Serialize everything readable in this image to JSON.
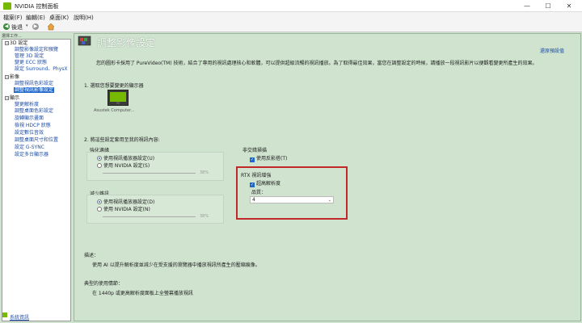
{
  "window": {
    "title": "NVIDIA 控制面板",
    "minimize": "—",
    "maximize": "☐",
    "close": "✕"
  },
  "menu": [
    "檔案(F)",
    "編輯(E)",
    "桌面(K)",
    "說明(H)"
  ],
  "toolbar": {
    "back": "後退",
    "back_glyph": "◀",
    "forward_glyph": "▶"
  },
  "task_label": "選擇工作...",
  "sidebar": {
    "categories": [
      {
        "label": "3D 設定",
        "items": [
          "調整影像設定和預覽",
          "管理 3D 設定",
          "變更 ECC 狀態",
          "設定 Surround、PhysX"
        ]
      },
      {
        "label": "影像",
        "items": [
          "調整視訊色彩設定",
          "調整視訊影像設定"
        ]
      },
      {
        "label": "顯示",
        "items": [
          "變更解析度",
          "調整桌面色彩設定",
          "旋轉顯示畫面",
          "檢視 HDCP 狀態",
          "設定數位音效",
          "調整桌面尺寸和位置",
          "設定 G-SYNC",
          "設定多台顯示器"
        ]
      }
    ],
    "selected": "調整視訊影像設定",
    "system_info": "系統資訊"
  },
  "main": {
    "title": "調整影像設定",
    "restore": "還原預設值",
    "description": "您的圖形卡採用了 PureVideo(TM) 技術，結合了專用的視訊處理核心和軟體，可以提供超級流暢的視訊播放。為了取得最佳效果，當您在調整設定的時候，請播放一段視訊影片以便觀看變更所產生的效果。",
    "section1": "1. 選取您想要變更的顯示器",
    "monitor_label": "Asustek Computer...",
    "section2": "2. 將這些設定套用至我的視訊內容:",
    "edge": {
      "label": "強化邊緣",
      "options": [
        "使用視訊播放器設定(U)",
        "使用 NVIDIA 設定(S)"
      ],
      "value": "38%"
    },
    "noise": {
      "label": "減少雜訊",
      "options": [
        "使用視訊播放器設定(D)",
        "使用 NVIDIA 設定(N)"
      ],
      "value": "38%"
    },
    "deinterlace": {
      "label": "非交錯掃描",
      "option": "使用反影搭(T)"
    },
    "rtx": {
      "label": "RTX 視訊增強",
      "option": "超高解析度",
      "quality_label": "品質：",
      "quality_value": "4"
    },
    "desc_label": "描述：",
    "desc_text": "使用 AI 以提升解析度並減少在受支援的瀏覽器中播放視訊所產生的壓縮痕像。",
    "usage_label": "典型的使用情節：",
    "usage_text": "在 1440p 或更高解析度面板上全螢幕播放視訊"
  },
  "colors": {
    "accent": "#1e66c8",
    "nvidia_green": "#76b900",
    "highlight": "#c0282a"
  }
}
